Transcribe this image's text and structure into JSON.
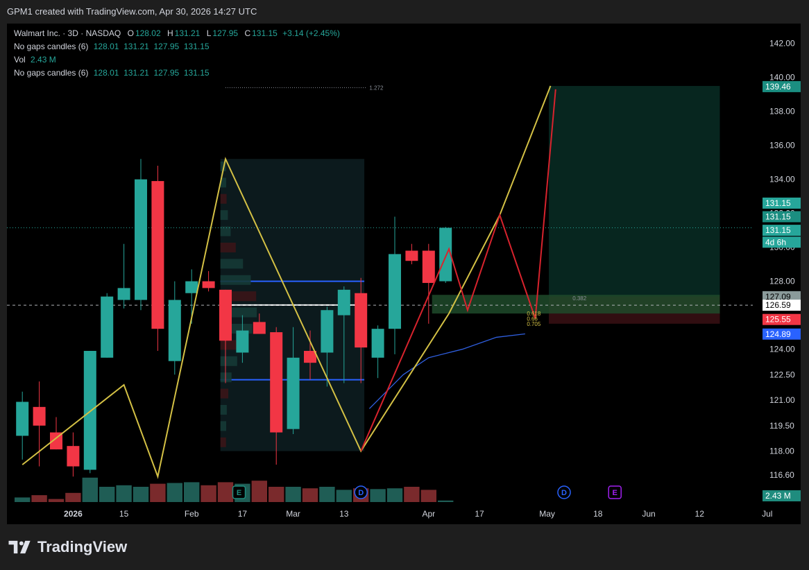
{
  "header": {
    "caption": "GPM1 created with TradingView.com, Apr 30, 2026 14:27 UTC"
  },
  "legend": {
    "symbol": "Walmart Inc. · 3D · NASDAQ",
    "o_label": "O",
    "o_value": "128.02",
    "h_label": "H",
    "h_value": "131.21",
    "l_label": "L",
    "l_value": "127.95",
    "c_label": "C",
    "c_value": "131.15",
    "change": "+3.14 (+2.45%)",
    "row2_name": "No gaps candles (6)",
    "row2_values": "128.01  131.21  127.95  131.15",
    "vol_name": "Vol",
    "vol_value": "2.43 M",
    "row4_name": "No gaps candles (6)",
    "row4_values": "128.01  131.21  127.95  131.15"
  },
  "brand": {
    "name": "TradingView",
    "logo_icon": "tradingview-logo-icon"
  },
  "colors": {
    "up": "#26a69a",
    "down": "#f23645",
    "volume_up": "#1f5d55",
    "volume_down": "#7a2a2c",
    "zigzag": "#d4c145",
    "ma": "#2f5fe0",
    "box_line": "#2962ff"
  },
  "chart_data": {
    "type": "candlestick",
    "symbol": "Walmart Inc. · 3D · NASDAQ",
    "x_ticks": [
      {
        "i": 3,
        "label": "2026"
      },
      {
        "i": 6,
        "label": "15"
      },
      {
        "i": 10,
        "label": "Feb"
      },
      {
        "i": 13,
        "label": "17"
      },
      {
        "i": 16,
        "label": "Mar"
      },
      {
        "i": 19,
        "label": "13"
      },
      {
        "i": 24,
        "label": "Apr"
      },
      {
        "i": 27,
        "label": "17"
      },
      {
        "i": 31,
        "label": "May"
      },
      {
        "i": 34,
        "label": "18"
      },
      {
        "i": 37,
        "label": "Jun"
      },
      {
        "i": 40,
        "label": "12"
      },
      {
        "i": 44,
        "label": "Jul"
      }
    ],
    "y_ticks": [
      116.6,
      118.0,
      119.5,
      121.0,
      122.5,
      124.0,
      128.0,
      130.0,
      132.0,
      134.0,
      136.0,
      138.0,
      140.0,
      142.0
    ],
    "y_range": [
      115.0,
      142.6
    ],
    "candles": [
      {
        "o": 118.9,
        "h": 121.5,
        "l": 117.5,
        "c": 120.9
      },
      {
        "o": 120.6,
        "h": 122.1,
        "l": 117.1,
        "c": 119.5
      },
      {
        "o": 119.1,
        "h": 120.0,
        "l": 118.4,
        "c": 118.1
      },
      {
        "o": 118.3,
        "h": 119.1,
        "l": 116.5,
        "c": 117.1
      },
      {
        "o": 116.9,
        "h": 123.4,
        "l": 116.7,
        "c": 123.9
      },
      {
        "o": 123.5,
        "h": 127.3,
        "l": 127.0,
        "c": 127.1
      },
      {
        "o": 126.9,
        "h": 130.2,
        "l": 126.4,
        "c": 127.6
      },
      {
        "o": 126.9,
        "h": 135.2,
        "l": 126.3,
        "c": 134.0
      },
      {
        "o": 133.9,
        "h": 134.8,
        "l": 123.9,
        "c": 125.2
      },
      {
        "o": 123.3,
        "h": 128.0,
        "l": 122.5,
        "c": 126.9
      },
      {
        "o": 127.3,
        "h": 128.7,
        "l": 125.5,
        "c": 128.0
      },
      {
        "o": 128.0,
        "h": 128.6,
        "l": 127.4,
        "c": 127.6
      },
      {
        "o": 127.5,
        "h": 127.4,
        "l": 122.0,
        "c": 124.5
      },
      {
        "o": 123.8,
        "h": 126.0,
        "l": 123.2,
        "c": 125.1
      },
      {
        "o": 125.6,
        "h": 126.1,
        "l": 124.9,
        "c": 124.9
      },
      {
        "o": 125.0,
        "h": 125.3,
        "l": 117.2,
        "c": 119.1
      },
      {
        "o": 119.3,
        "h": 125.3,
        "l": 119.0,
        "c": 123.5
      },
      {
        "o": 123.9,
        "h": 125.1,
        "l": 122.2,
        "c": 123.2
      },
      {
        "o": 123.8,
        "h": 126.5,
        "l": 121.8,
        "c": 126.3
      },
      {
        "o": 126.0,
        "h": 127.7,
        "l": 122.0,
        "c": 127.5
      },
      {
        "o": 127.3,
        "h": 128.2,
        "l": 122.0,
        "c": 124.1
      },
      {
        "o": 123.5,
        "h": 125.4,
        "l": 122.3,
        "c": 125.2
      },
      {
        "o": 125.2,
        "h": 131.8,
        "l": 123.7,
        "c": 129.6
      },
      {
        "o": 129.8,
        "h": 130.2,
        "l": 129.0,
        "c": 129.2
      },
      {
        "o": 129.8,
        "h": 130.2,
        "l": 125.5,
        "c": 127.9
      },
      {
        "o": 128.0,
        "h": 131.2,
        "l": 127.9,
        "c": 131.15
      }
    ],
    "volume_relative": [
      0.3,
      0.45,
      0.2,
      0.6,
      1.6,
      1.0,
      1.1,
      1.0,
      1.2,
      1.25,
      1.3,
      1.1,
      1.3,
      1.2,
      1.4,
      1.0,
      1.0,
      0.9,
      1.0,
      0.8,
      0.9,
      0.85,
      0.9,
      1.0,
      0.8,
      0.1
    ],
    "volume_first_i": 0,
    "zigzag": [
      {
        "i": 0,
        "p": 117.2
      },
      {
        "i": 6,
        "p": 121.9
      },
      {
        "i": 8,
        "p": 116.5
      },
      {
        "i": 12,
        "p": 135.2
      },
      {
        "i": 20,
        "p": 118.0
      },
      {
        "i": 25.2,
        "p": 126.1
      },
      {
        "i": 28.2,
        "p": 131.9
      },
      {
        "i": 31.2,
        "p": 139.5
      }
    ],
    "projection_red": [
      {
        "i": 20,
        "p": 118.0
      },
      {
        "i": 25.2,
        "p": 129.9
      },
      {
        "i": 26.3,
        "p": 126.3
      },
      {
        "i": 28.2,
        "p": 131.9
      },
      {
        "i": 30.3,
        "p": 125.8
      },
      {
        "i": 31.5,
        "p": 139.3
      }
    ],
    "ma_line": [
      {
        "i": 20.5,
        "p": 120.5
      },
      {
        "i": 22.5,
        "p": 122.5
      },
      {
        "i": 24,
        "p": 123.5
      },
      {
        "i": 26,
        "p": 124.0
      },
      {
        "i": 28,
        "p": 124.7
      },
      {
        "i": 29.7,
        "p": 124.9
      }
    ],
    "range_box": {
      "i0": 11.7,
      "i1": 20.2,
      "high": 135.2,
      "low": 118.0,
      "top_line": 128.0,
      "bottom_line": 122.2,
      "mid_line": 126.6
    },
    "long_position": {
      "i0": 31.1,
      "i1": 41.2,
      "target": 139.5,
      "entry": 127.1,
      "stop": 125.5,
      "zone_low": 126.1
    },
    "fib_labels": [
      {
        "label": "1.272",
        "p": 139.4
      },
      {
        "label": "0.382",
        "p": 127.0
      },
      {
        "label": "0.618",
        "p": 126.1
      },
      {
        "label": "0.66",
        "p": 125.8
      },
      {
        "label": "0.705",
        "p": 125.5
      }
    ],
    "dashed_price": 126.59,
    "dotted_price": 131.15,
    "price_tags": [
      {
        "label": "139.46",
        "p": 139.46,
        "bg": "#1b8e81",
        "fg": "#ffffff"
      },
      {
        "label": "131.15",
        "p": 132.6,
        "bg": "#26a69a",
        "fg": "#ffffff"
      },
      {
        "label": "131.15",
        "p": 131.8,
        "bg": "#1b8e81",
        "fg": "#ffffff"
      },
      {
        "label": "131.15",
        "p": 131.0,
        "bg": "#26a69a",
        "fg": "#ffffff"
      },
      {
        "label": "4d 6h",
        "p": 130.3,
        "bg": "#26a69a",
        "fg": "#ffffff"
      },
      {
        "label": "127.09",
        "p": 127.09,
        "bg": "#8a9a9a",
        "fg": "#000000"
      },
      {
        "label": "126.59",
        "p": 126.59,
        "bg": "#ffffff",
        "fg": "#000000"
      },
      {
        "label": "125.55",
        "p": 125.75,
        "bg": "#f23645",
        "fg": "#ffffff"
      },
      {
        "label": "124.89",
        "p": 124.89,
        "bg": "#2962ff",
        "fg": "#ffffff"
      }
    ],
    "volume_tag": {
      "label": "2.43 M",
      "bg": "#1f8c7e",
      "fg": "#ffffff"
    },
    "event_markers": [
      {
        "i": 12.8,
        "label": "E",
        "color": "#1f8c7e"
      },
      {
        "i": 20.0,
        "label": "D",
        "color": "#2962ff"
      },
      {
        "i": 32.0,
        "label": "D",
        "color": "#2962ff"
      },
      {
        "i": 35.0,
        "label": "E",
        "color": "#a020f0"
      }
    ]
  }
}
